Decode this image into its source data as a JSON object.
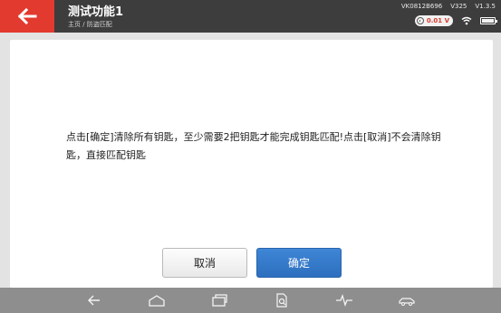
{
  "header": {
    "title": "测试功能1",
    "breadcrumb": "主页 / 防盗匹配"
  },
  "status": {
    "serial": "VK0812B696",
    "version_label": "V325",
    "software_version": "V1.3.5",
    "voltage": "0.01 V",
    "accent_color": "#e23a2e"
  },
  "dialog": {
    "message": "点击[确定]清除所有钥匙，至少需要2把钥匙才能完成钥匙匹配!点击[取消]不会清除钥匙，直接匹配钥匙",
    "cancel_label": "取消",
    "confirm_label": "确定"
  },
  "navbar": {
    "icons": [
      "back-icon",
      "home-icon",
      "recent-apps-icon",
      "file-search-icon",
      "waveform-icon",
      "car-icon"
    ]
  }
}
